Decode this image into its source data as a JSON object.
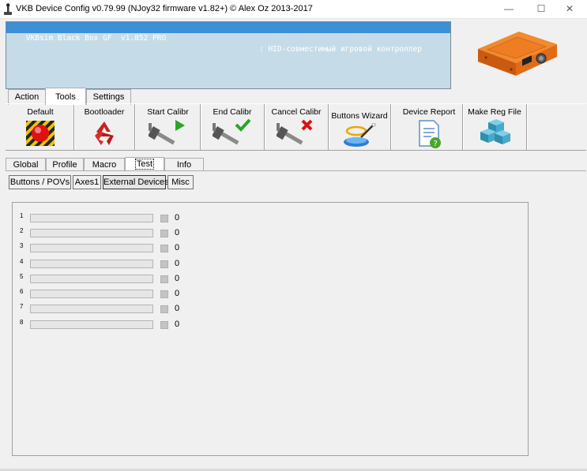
{
  "window": {
    "title": "VKB Device Config v0.79.99 (NJoy32 firmware v1.82+) © Alex Oz 2013-2017",
    "controls": {
      "minimize": "—",
      "maximize": "☐",
      "close": "✕"
    }
  },
  "device_list": {
    "selected_name": "VKBsim Black Box GF  v1.852 PRO",
    "selected_desc": ": HID-совместимый игровой контроллер"
  },
  "main_tabs": [
    "Action",
    "Tools",
    "Settings"
  ],
  "active_main_tab": "Tools",
  "toolbar": {
    "default": "Default",
    "bootloader": "Bootloader",
    "start_calibr": "Start Calibr",
    "end_calibr": "End Calibr",
    "cancel_calibr": "Cancel Calibr",
    "buttons_wizard": "Buttons Wizard",
    "device_report": "Device Report",
    "make_reg_file": "Make Reg File"
  },
  "sub_tabs": [
    "Global",
    "Profile",
    "Macro",
    "Test",
    "Info"
  ],
  "active_sub_tab": "Test",
  "test_buttons": [
    "Buttons / POVs",
    "Axes1",
    "External Devices",
    "Misc"
  ],
  "active_test_button": "External Devices",
  "external_devices": [
    {
      "num": "1",
      "value": "0"
    },
    {
      "num": "2",
      "value": "0"
    },
    {
      "num": "3",
      "value": "0"
    },
    {
      "num": "4",
      "value": "0"
    },
    {
      "num": "5",
      "value": "0"
    },
    {
      "num": "6",
      "value": "0"
    },
    {
      "num": "7",
      "value": "0"
    },
    {
      "num": "8",
      "value": "0"
    }
  ],
  "colors": {
    "selection": "#3d8fd6",
    "list_bg": "#c5dce8",
    "device_orange": "#e8701a"
  }
}
